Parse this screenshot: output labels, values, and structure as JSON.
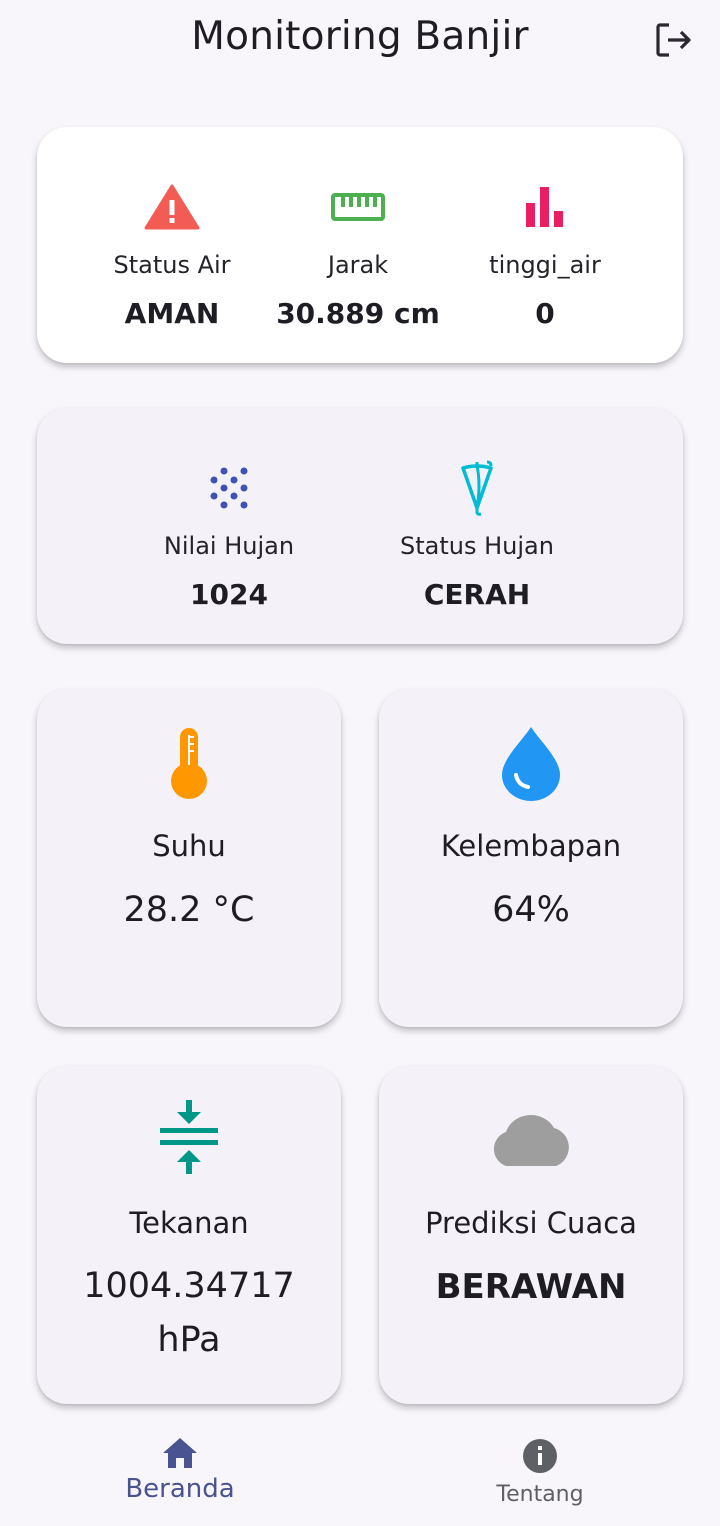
{
  "app": {
    "title": "Monitoring Banjir",
    "logout_icon": "logout-icon"
  },
  "water_card": {
    "items": [
      {
        "icon": "warning-icon",
        "label": "Status Air",
        "value": "AMAN",
        "color": "#f25c54"
      },
      {
        "icon": "ruler-icon",
        "label": "Jarak",
        "value": "30.889 cm",
        "color": "#4caf50"
      },
      {
        "icon": "bar-chart-icon",
        "label": "tinggi_air",
        "value": "0",
        "color": "#e91e63"
      }
    ]
  },
  "rain_card": {
    "items": [
      {
        "icon": "rain-dots-icon",
        "label": "Nilai Hujan",
        "value": "1024",
        "color": "#3f51b5"
      },
      {
        "icon": "umbrella-icon",
        "label": "Status Hujan",
        "value": "CERAH",
        "color": "#00bcd4"
      }
    ]
  },
  "tiles": [
    {
      "icon": "thermometer-icon",
      "label": "Suhu",
      "value": "28.2 °C",
      "color": "#ff9800"
    },
    {
      "icon": "water-drop-icon",
      "label": "Kelembapan",
      "value": "64%",
      "color": "#2196f3"
    },
    {
      "icon": "pressure-icon",
      "label": "Tekanan",
      "value_line1": "1004.34717",
      "value_line2": "hPa",
      "color": "#009688"
    },
    {
      "icon": "cloud-icon",
      "label": "Prediksi Cuaca",
      "value": "BERAWAN",
      "color": "#9e9e9e"
    }
  ],
  "nav": {
    "items": [
      {
        "icon": "home-icon",
        "label": "Beranda",
        "active": true,
        "color": "#4a5391"
      },
      {
        "icon": "info-icon",
        "label": "Tentang",
        "active": false,
        "color": "#5f5f66"
      }
    ]
  }
}
